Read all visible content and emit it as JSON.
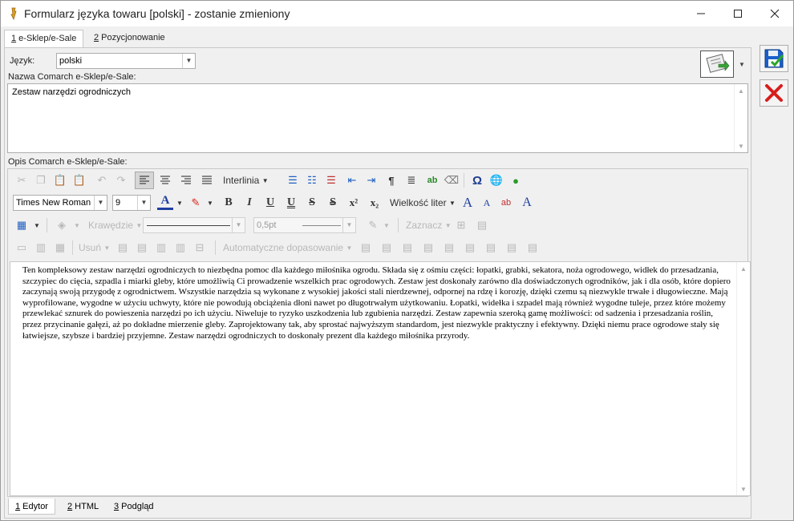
{
  "window": {
    "title": "Formularz języka towaru [polski] - zostanie zmieniony"
  },
  "tabs": [
    {
      "hotkey": "1",
      "label": " e-Sklep/e-Sale"
    },
    {
      "hotkey": "2",
      "label": " Pozycjonowanie"
    }
  ],
  "form": {
    "language_label": "Język:",
    "language_value": "polski",
    "name_label": "Nazwa Comarch e-Sklep/e-Sale:",
    "name_value": "Zestaw narzędzi ogrodniczych",
    "desc_label": "Opis Comarch e-Sklep/e-Sale:"
  },
  "toolbar": {
    "line_spacing": "Interlinia",
    "font_name": "Times New Roman",
    "font_size": "9",
    "font_size_label": "Wielkość liter",
    "borders_label": "Krawędzie",
    "border_width": "0,5pt",
    "select_label": "Zaznacz",
    "delete_label": "Usuń",
    "autofit_label": "Automatyczne dopasowanie"
  },
  "document": {
    "text": "Ten kompleksowy zestaw narzędzi ogrodniczych to niezbędna pomoc dla każdego miłośnika ogrodu. Składa się z ośmiu części: łopatki, grabki, sekatora, noża ogrodowego, widłek do przesadzania, szczypiec do cięcia, szpadla i miarki gleby, które umożliwią Ci prowadzenie wszelkich prac ogrodowych. Zestaw jest doskonały zarówno dla doświadczonych ogrodników, jak i dla osób, które dopiero zaczynają swoją przygodę z ogrodnictwem. Wszystkie narzędzia są wykonane z wysokiej jakości stali nierdzewnej, odpornej na rdzę i korozję, dzięki czemu są niezwykle trwałe i długowieczne. Mają wyprofilowane, wygodne w użyciu uchwyty, które nie powodują obciążenia dłoni nawet po długotrwałym użytkowaniu. Łopatki, widełka i szpadel mają również wygodne tuleje, przez które możemy przewlekać sznurek do powieszenia narzędzi po ich użyciu. Niweluje to ryzyko uszkodzenia lub zgubienia narzędzi. Zestaw zapewnia szeroką gamę możliwości: od sadzenia i przesadzania roślin, przez przycinanie gałęzi, aż po dokładne mierzenie gleby. Zaprojektowany tak, aby sprostać najwyższym standardom, jest niezwykle praktyczny i efektywny. Dzięki niemu prace ogrodowe stały się łatwiejsze, szybsze i bardziej przyjemne. Zestaw narzędzi ogrodniczych to doskonały prezent dla każdego miłośnika przyrody."
  },
  "bottom_tabs": [
    {
      "hotkey": "1",
      "label": " Edytor"
    },
    {
      "hotkey": "2",
      "label": " HTML"
    },
    {
      "hotkey": "3",
      "label": " Podgląd"
    }
  ],
  "colors": {
    "save": "#1a5fc9",
    "cancel": "#d81e1e",
    "font_color": "#1f3fa0",
    "highlight": "#d8261c"
  }
}
